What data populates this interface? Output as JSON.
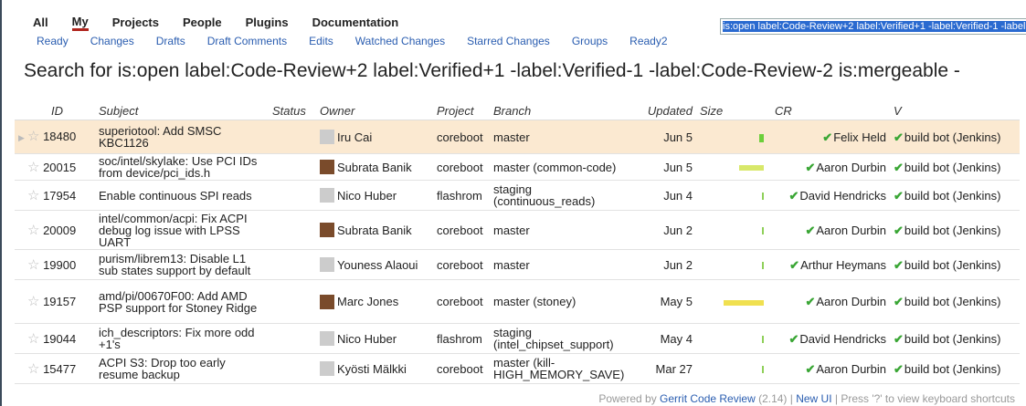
{
  "topnav": [
    "All",
    "My",
    "Projects",
    "People",
    "Plugins",
    "Documentation"
  ],
  "subnav": [
    "Ready",
    "Changes",
    "Drafts",
    "Draft Comments",
    "Edits",
    "Watched Changes",
    "Starred Changes",
    "Groups",
    "Ready2"
  ],
  "search": {
    "value": "is:open label:Code-Review+2 label:Verified+1 -label:Verified-1 -label:Code-Review-2 is:mergeable"
  },
  "page_title": "Search for is:open label:Code-Review+2 label:Verified+1 -label:Verified-1 -label:Code-Review-2 is:mergeable -",
  "headers": [
    "ID",
    "Subject",
    "Status",
    "Owner",
    "Project",
    "Branch",
    "Updated",
    "Size",
    "CR",
    "V"
  ],
  "rows": [
    {
      "id": "18480",
      "subject": "superiotool: Add SMSC KBC1126",
      "status": "",
      "owner": "Iru Cai",
      "avatar": "default",
      "project": "coreboot",
      "branch": "master",
      "updated": "Jun 5",
      "size": 0.1,
      "cr": "Felix Held",
      "v": "build bot (Jenkins)"
    },
    {
      "id": "20015",
      "subject": "soc/intel/skylake: Use PCI IDs from device/pci_ids.h",
      "status": "",
      "owner": "Subrata Banik",
      "avatar": "photo",
      "project": "coreboot",
      "branch": "master (common-code)",
      "updated": "Jun 5",
      "size": 0.62,
      "cr": "Aaron Durbin",
      "v": "build bot (Jenkins)"
    },
    {
      "id": "17954",
      "subject": "Enable continuous SPI reads",
      "status": "",
      "owner": "Nico Huber",
      "avatar": "default",
      "project": "flashrom",
      "branch": "staging (continuous_reads)",
      "updated": "Jun 4",
      "size": 0.05,
      "cr": "David Hendricks",
      "v": "build bot (Jenkins)"
    },
    {
      "id": "20009",
      "subject": "intel/common/acpi: Fix ACPI debug log issue with LPSS UART",
      "status": "",
      "owner": "Subrata Banik",
      "avatar": "photo",
      "project": "coreboot",
      "branch": "master",
      "updated": "Jun 2",
      "size": 0.05,
      "cr": "Aaron Durbin",
      "v": "build bot (Jenkins)"
    },
    {
      "id": "19900",
      "subject": "purism/librem13: Disable L1 sub states support by default",
      "status": "",
      "owner": "Youness Alaoui",
      "avatar": "default",
      "project": "coreboot",
      "branch": "master",
      "updated": "Jun 2",
      "size": 0.05,
      "cr": "Arthur Heymans",
      "v": "build bot (Jenkins)"
    },
    {
      "id": "19157",
      "subject": "amd/pi/00670F00: Add AMD PSP support for Stoney Ridge",
      "status": "",
      "owner": "Marc Jones",
      "avatar": "photo",
      "project": "coreboot",
      "branch": "master (stoney)",
      "updated": "May 5",
      "size": 1.0,
      "cr": "Aaron Durbin",
      "v": "build bot (Jenkins)"
    },
    {
      "id": "19044",
      "subject": "ich_descriptors: Fix more odd +1's",
      "status": "",
      "owner": "Nico Huber",
      "avatar": "default",
      "project": "flashrom",
      "branch": "staging (intel_chipset_support)",
      "updated": "May 4",
      "size": 0.05,
      "cr": "David Hendricks",
      "v": "build bot (Jenkins)"
    },
    {
      "id": "15477",
      "subject": "ACPI S3: Drop too early resume backup",
      "status": "",
      "owner": "Kyösti Mälkki",
      "avatar": "default",
      "project": "coreboot",
      "branch": "master (kill-HIGH_MEMORY_SAVE)",
      "updated": "Mar 27",
      "size": 0.05,
      "cr": "Aaron Durbin",
      "v": "build bot (Jenkins)"
    }
  ],
  "footer": {
    "prefix": "Powered by ",
    "gerrit": "Gerrit Code Review",
    "version": " (2.14) | ",
    "newui": "New UI",
    "rest": " | Press '?' to view keyboard shortcuts"
  },
  "colors": {
    "link": "#2a5db0",
    "selected_row": "#fbe9d1",
    "size_bar": "#d8e86a",
    "check": "#3aa635",
    "accent": "#b0251e"
  }
}
